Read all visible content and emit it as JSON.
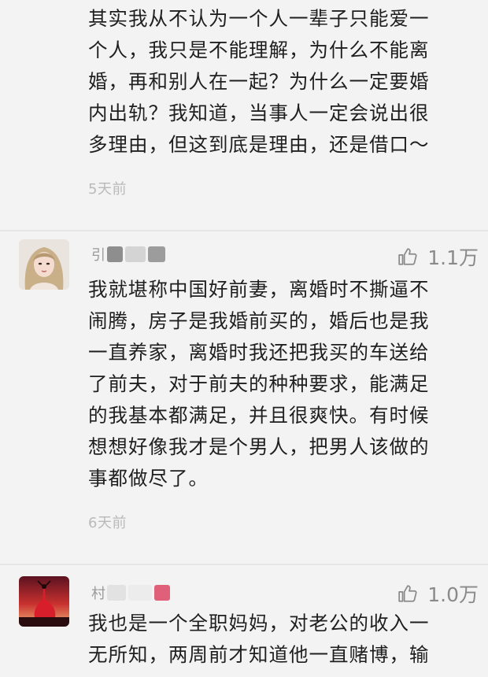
{
  "comments": [
    {
      "text": "其实我从不认为一个人一辈子只能爱一\n个人，我只是不能理解，为什么不能离\n婚，再和别人在一起？为什么一定要婚\n内出轨？我知道，当事人一定会说出很\n多理由，但这到底是理由，还是借口～",
      "time": "5天前"
    },
    {
      "user_initial": "引",
      "likes": "1.1万",
      "text": "我就堪称中国好前妻，离婚时不撕逼不\n闹腾，房子是我婚前买的，婚后也是我\n一直养家，离婚时我还把我买的车送给\n了前夫，对于前夫的种种要求，能满足\n的我基本都满足，并且很爽快。有时候\n想想好像我才是个男人，把男人该做的\n事都做尽了。",
      "time": "6天前"
    },
    {
      "user_initial": "村",
      "likes": "1.0万",
      "text": "我也是一个全职妈妈，对老公的收入一\n无所知，两周前才知道他一直赌博，输"
    }
  ],
  "icons": {
    "like": "thumbs-up-icon"
  },
  "colors": {
    "background": "#f3f3f3",
    "text": "#1f1f1f",
    "meta": "#b9b9b9",
    "likes": "#8a8a8a"
  }
}
